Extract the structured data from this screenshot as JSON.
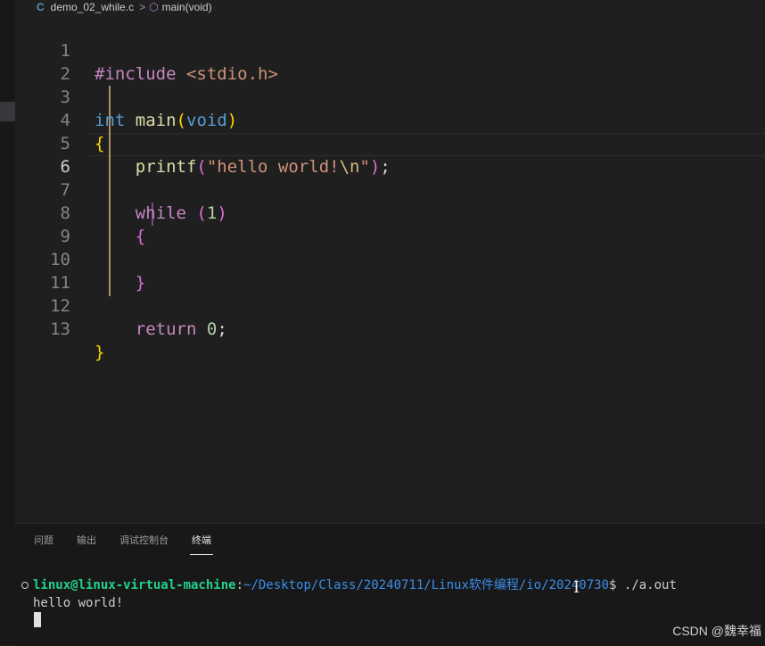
{
  "breadcrumb": {
    "file_icon": "C",
    "file_name": "demo_02_while.c",
    "separator": ">",
    "symbol_icon": "⬡",
    "symbol_name": "main(void)"
  },
  "editor": {
    "line_numbers": [
      "1",
      "2",
      "3",
      "4",
      "5",
      "6",
      "7",
      "8",
      "9",
      "10",
      "11",
      "12",
      "13"
    ],
    "active_line": 6,
    "lines": {
      "l1": {
        "directive": "#include",
        "header": "<stdio.h>"
      },
      "l3": {
        "type": "int",
        "name": "main",
        "open": "(",
        "param": "void",
        "close": ")"
      },
      "l4": {
        "brace": "{"
      },
      "l5": {
        "fn": "printf",
        "open": "(",
        "str_a": "\"hello world!",
        "esc": "\\n",
        "str_b": "\"",
        "close": ")",
        "semi": ";"
      },
      "l7": {
        "kw": "while",
        "open": "(",
        "num": "1",
        "close": ")"
      },
      "l8": {
        "brace": "{"
      },
      "l10": {
        "brace": "}"
      },
      "l12": {
        "kw": "return",
        "num": "0",
        "semi": ";"
      },
      "l13": {
        "brace": "}"
      }
    }
  },
  "panel": {
    "tabs": [
      {
        "label": "问题"
      },
      {
        "label": "输出"
      },
      {
        "label": "调试控制台"
      },
      {
        "label": "终端"
      }
    ],
    "active_tab": "终端"
  },
  "terminal": {
    "user_host": "linux@linux-virtual-machine",
    "colon": ":",
    "path": "~/Desktop/Class/20240711/Linux软件编程/io/20240730",
    "prompt_cmd": "$ ./a.out",
    "output": "hello world!",
    "cursor_icon": "text-cursor-icon"
  },
  "watermark": {
    "text": "CSDN @魏幸福"
  },
  "colors": {
    "background": "#1f1f1f",
    "keyword": "#569cd6",
    "control": "#c586c0",
    "string": "#ce9178",
    "function": "#dcdcaa",
    "number": "#b5cea8",
    "terminal_user": "#23d18b",
    "terminal_path": "#3b8eea"
  }
}
